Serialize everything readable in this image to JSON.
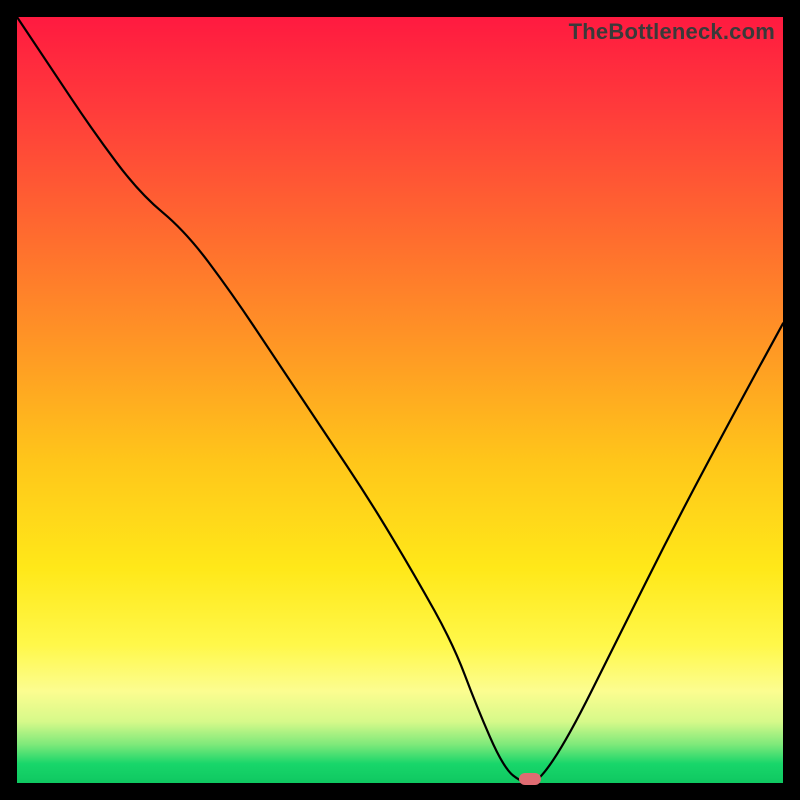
{
  "watermark": "TheBottleneck.com",
  "colors": {
    "marker": "#e06b72",
    "curve": "#000000"
  },
  "chart_data": {
    "type": "line",
    "title": "",
    "xlabel": "",
    "ylabel": "",
    "xlim": [
      0,
      100
    ],
    "ylim": [
      0,
      100
    ],
    "grid": false,
    "series": [
      {
        "name": "bottleneck-curve",
        "x": [
          0,
          4,
          10,
          16,
          22,
          28,
          34,
          40,
          46,
          52,
          57,
          60,
          63.5,
          66,
          68,
          72,
          78,
          86,
          94,
          100
        ],
        "values": [
          100,
          94,
          85,
          77,
          72,
          64,
          55,
          46,
          37,
          27,
          18,
          10,
          2,
          0,
          0,
          6,
          18,
          34,
          49,
          60
        ]
      }
    ],
    "marker": {
      "x": 67,
      "y": 0.5
    }
  }
}
